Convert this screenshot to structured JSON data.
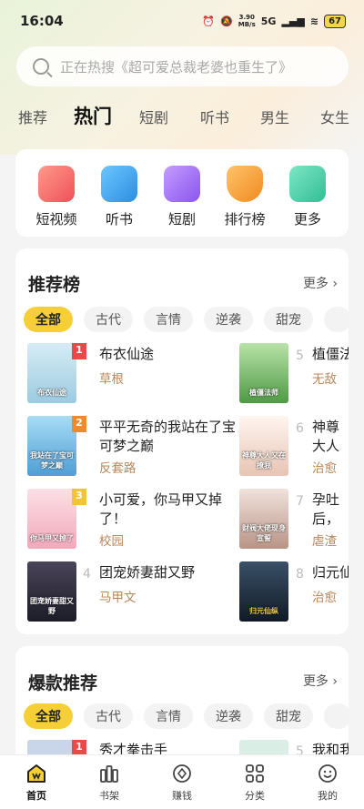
{
  "status": {
    "time": "16:04",
    "net_speed": "3.90",
    "net_unit": "MB/s",
    "signal": "5G",
    "battery": "67"
  },
  "search": {
    "placeholder": "正在热搜《超可爱总裁老婆也重生了》"
  },
  "tabs": [
    "推荐",
    "热门",
    "短剧",
    "听书",
    "男生",
    "女生"
  ],
  "active_tab": "热门",
  "categories": [
    {
      "label": "短视频",
      "icon": "short-video-icon",
      "color": "#f06a6a"
    },
    {
      "label": "听书",
      "icon": "audiobook-icon",
      "color": "#3aa0e8"
    },
    {
      "label": "短剧",
      "icon": "short-drama-icon",
      "color": "#9c6cf0"
    },
    {
      "label": "排行榜",
      "icon": "trophy-icon",
      "color": "#f59a22"
    },
    {
      "label": "更多",
      "icon": "more-apps-icon",
      "color": "#40c8a0"
    }
  ],
  "recommend": {
    "title": "推荐榜",
    "more": "更多",
    "chips": [
      "全部",
      "古代",
      "言情",
      "逆袭",
      "甜宠"
    ],
    "books": [
      {
        "rank": "1",
        "title": "布衣仙途",
        "tag": "草根",
        "cover_text": "布衣仙途",
        "cover_color": "#bfe1f0"
      },
      {
        "rank": "2",
        "title": "平平无奇的我站在了宝可梦之巅",
        "tag": "反套路",
        "cover_text": "我站在了宝可梦之巅",
        "cover_color": "#7ec4e8"
      },
      {
        "rank": "3",
        "title": "小可爱，你马甲又掉了！",
        "tag": "校园",
        "cover_text": "你马甲又掉了",
        "cover_color": "#f6c7d2"
      },
      {
        "rank": "4",
        "title": "团宠娇妻甜又野",
        "tag": "马甲文",
        "cover_text": "团宠娇妻甜又野",
        "cover_color": "#2c2c3a"
      },
      {
        "rank": "5",
        "title": "植僵法师",
        "tag": "无敌",
        "cover_text": "植僵法师",
        "cover_color": "#7cbf6a"
      },
      {
        "rank": "6",
        "title": "神尊大人又在撩我！",
        "tag": "治愈",
        "cover_text": "神尊大人又在撩我",
        "cover_color": "#f3e6df"
      },
      {
        "rank": "7",
        "title": "孕吐后，财阀大佬现身宣誓主权",
        "tag": "虐渣",
        "cover_text": "财阀大佬现身宣誓",
        "cover_color": "#e9d6cf"
      },
      {
        "rank": "8",
        "title": "归元仙纵",
        "tag": "治愈",
        "cover_text": "归元仙纵",
        "cover_color": "#1d2a3a"
      }
    ]
  },
  "explosive": {
    "title": "爆款推荐",
    "more": "更多",
    "chips": [
      "全部",
      "古代",
      "言情",
      "逆袭",
      "甜宠"
    ],
    "books": [
      {
        "rank": "1",
        "title": "秀才拳击手",
        "cover_color": "#c9d6e9"
      },
      {
        "rank": "5",
        "title": "我和我",
        "cover_color": "#d9efe6"
      }
    ]
  },
  "nav": [
    {
      "label": "首页",
      "icon": "home-icon",
      "active": true
    },
    {
      "label": "书架",
      "icon": "bookshelf-icon",
      "active": false
    },
    {
      "label": "赚钱",
      "icon": "earn-icon",
      "active": false
    },
    {
      "label": "分类",
      "icon": "category-icon",
      "active": false
    },
    {
      "label": "我的",
      "icon": "profile-icon",
      "active": false
    }
  ]
}
